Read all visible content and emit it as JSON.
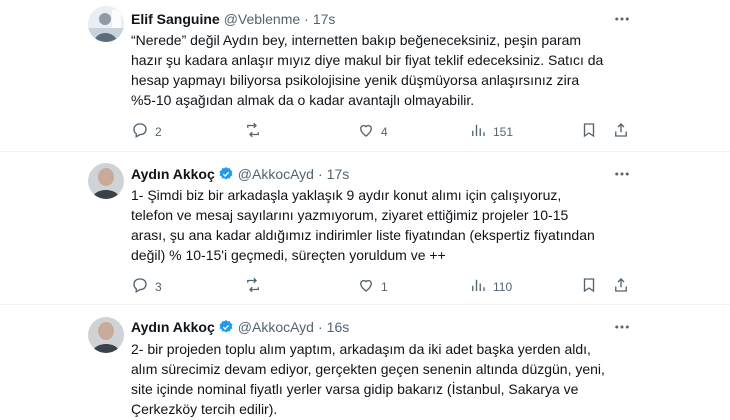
{
  "tweets": [
    {
      "name": "Elif Sanguine",
      "handle": "@Veblenme",
      "dot": "·",
      "time": "17s",
      "verified": false,
      "text": [
        "“Nerede” değil Aydın bey, internetten bakıp beğeneceksiniz, peşin param",
        "hazır şu kadara anlaşır mıyız diye makul bir fiyat teklif edeceksiniz. Satıcı da",
        "hesap yapmayı biliyorsa psikolojisine yenik düşmüyorsa anlaşırsınız zira",
        "%5-10 aşağıdan almak da o kadar avantajlı olmayabilir."
      ],
      "replies": "2",
      "retweets": "",
      "likes": "4",
      "views": "151"
    },
    {
      "name": "Aydın Akkoç",
      "handle": "@AkkocAyd",
      "dot": "·",
      "time": "17s",
      "verified": true,
      "text": [
        "1- Şimdi biz bir arkadaşla yaklaşık 9 aydır konut alımı için çalışıyoruz,",
        "telefon ve mesaj sayılarını  yazmıyorum, ziyaret ettiğimiz projeler 10-15",
        "arası, şu ana kadar aldığımız indirimler liste fiyatından (ekspertiz fiyatından",
        "değil) % 10-15'i geçmedi, süreçten yoruldum ve ++"
      ],
      "replies": "3",
      "retweets": "",
      "likes": "1",
      "views": "110"
    },
    {
      "name": "Aydın Akkoç",
      "handle": "@AkkocAyd",
      "dot": "·",
      "time": "16s",
      "verified": true,
      "text": [
        "2- bir projeden toplu alım yaptım, arkadaşım da iki adet başka yerden aldı,",
        "alım sürecimiz devam ediyor, gerçekten geçen senenin altında düzgün, yeni,",
        "site içinde nominal fiyatlı yerler varsa gidip bakarız (İstanbul, Sakarya ve",
        "Çerkezköy tercih edilir)."
      ]
    }
  ],
  "colors": {
    "muted": "#536471",
    "verified": "#1d9bf0",
    "text": "#0f1419"
  },
  "icons": [
    "avatar",
    "verified-badge-icon",
    "more-icon",
    "reply-icon",
    "retweet-icon",
    "like-icon",
    "views-icon",
    "bookmark-icon",
    "share-icon"
  ]
}
